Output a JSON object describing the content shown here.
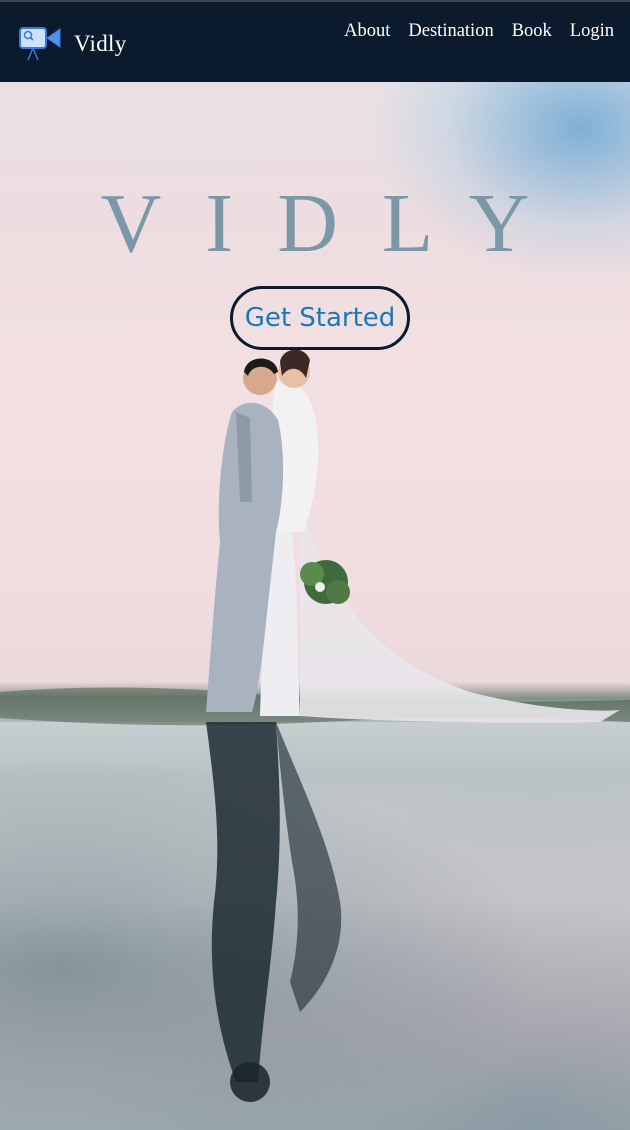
{
  "navbar": {
    "brand_name": "Vidly",
    "links": [
      "About",
      "Destination",
      "Book",
      "Login"
    ],
    "background": "#0b1b2d"
  },
  "hero": {
    "title": "VIDLY",
    "cta_label": "Get Started",
    "title_color": "#7a98a8",
    "cta_color": "#1b78b8"
  },
  "icons": {
    "logo": "video-camera-icon"
  }
}
